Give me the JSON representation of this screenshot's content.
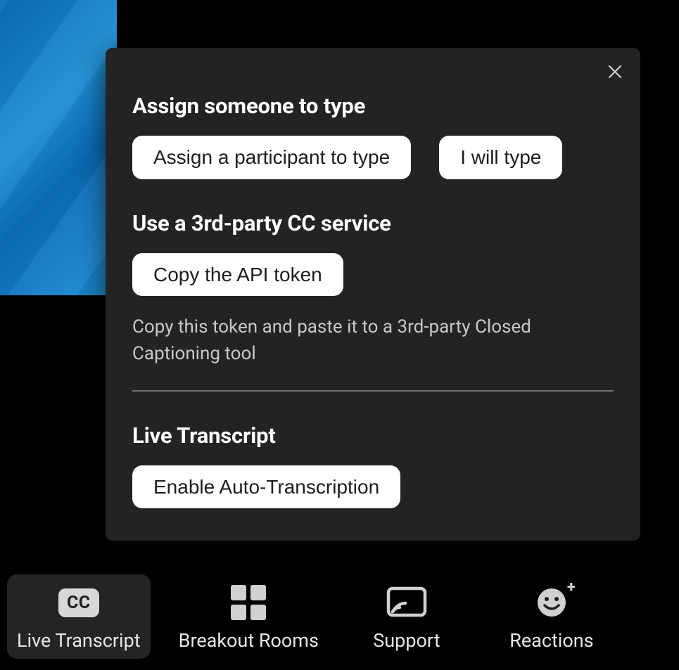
{
  "popup": {
    "close_label": "Close",
    "sections": {
      "assign": {
        "heading": "Assign someone to type",
        "assign_participant_label": "Assign a participant to type",
        "i_will_type_label": "I will type"
      },
      "third_party": {
        "heading": "Use a 3rd-party CC service",
        "copy_token_label": "Copy the API token",
        "helper": "Copy this token and paste it to a 3rd-party Closed Captioning tool"
      },
      "live_transcript": {
        "heading": "Live Transcript",
        "enable_label": "Enable Auto-Transcription"
      }
    }
  },
  "toolbar": {
    "live_transcript": {
      "label": "Live Transcript",
      "badge": "CC"
    },
    "breakout_rooms": {
      "label": "Breakout Rooms"
    },
    "support": {
      "label": "Support"
    },
    "reactions": {
      "label": "Reactions"
    }
  }
}
